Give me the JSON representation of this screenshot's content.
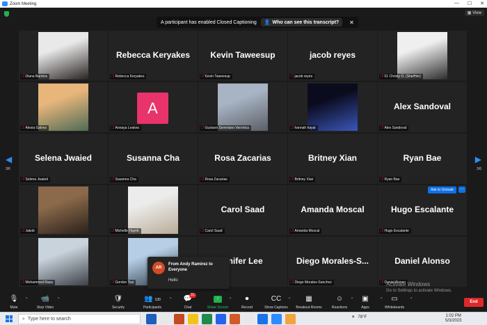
{
  "window": {
    "title": "Zoom Meeting",
    "controls": [
      "—",
      "☐",
      "✕"
    ],
    "view_label": "View"
  },
  "banner": {
    "text": "A participant has enabled Closed Captioning",
    "button_label": "Who can see this transcript?",
    "close_glyph": "✕"
  },
  "pagination": {
    "left": "3/6",
    "right": "3/6",
    "left_arrow": "◀",
    "right_arrow": "▶"
  },
  "participants": [
    {
      "name": "Diana Barrera",
      "type": "photo",
      "colors": [
        "#e9e9e9",
        "#2a2523"
      ]
    },
    {
      "name": "Rebecca Keryakes",
      "type": "name"
    },
    {
      "name": "Kevin Taweesup",
      "type": "name"
    },
    {
      "name": "jacob reyes",
      "type": "name"
    },
    {
      "name": "01 Christy O. (She/Her)",
      "type": "photo",
      "colors": [
        "#efefef",
        "#2e2e2e"
      ]
    },
    {
      "name": "Alexia Galvez",
      "type": "photo",
      "colors": [
        "#e8b57a",
        "#4d6b57"
      ]
    },
    {
      "name": "Annaya Leakes",
      "type": "avatar",
      "avatar_letter": "A"
    },
    {
      "name": "Gustavo Severiano Veronica",
      "type": "photo",
      "colors": [
        "#a8b4c4",
        "#5a5f66"
      ]
    },
    {
      "name": "hannah hayal",
      "type": "photo",
      "colors": [
        "#0b0b1e",
        "#3a56b8"
      ]
    },
    {
      "name": "Alex Sandoval",
      "type": "name"
    },
    {
      "name": "Selena Jwaied",
      "type": "name"
    },
    {
      "name": "Susanna Cha",
      "type": "name"
    },
    {
      "name": "Rosa Zacarias",
      "type": "name"
    },
    {
      "name": "Britney Xian",
      "type": "name"
    },
    {
      "name": "Ryan Bae",
      "type": "name"
    },
    {
      "name": "Jakob",
      "type": "photo",
      "colors": [
        "#8b6a4b",
        "#2b211a"
      ]
    },
    {
      "name": "Michelle Huynh",
      "type": "photo",
      "colors": [
        "#ececec",
        "#b9ac97"
      ]
    },
    {
      "name": "Carol Saad",
      "type": "name"
    },
    {
      "name": "Amanda Moscal",
      "type": "name"
    },
    {
      "name": "Hugo Escalante",
      "type": "name",
      "ask_to_unmute": "Ask to Unmute",
      "more": "···"
    },
    {
      "name": "Mohammed Raza",
      "type": "photo",
      "colors": [
        "#c9d3dc",
        "#3d4147"
      ]
    },
    {
      "name": "Gordon Tsui",
      "type": "photo",
      "colors": [
        "#b7cfe6",
        "#2d3b4a"
      ]
    },
    {
      "name": "Jennifer Lee",
      "type": "name",
      "big_label": "nnifer Lee"
    },
    {
      "name": "Diego Morales-Sanchez",
      "type": "name",
      "big_label": "Diego Morales-S..."
    },
    {
      "name": "Daniel Alonso",
      "type": "name"
    }
  ],
  "chat_popup": {
    "avatar": "AR",
    "from": "From Andy Ramirez to Everyone",
    "message": "Hello"
  },
  "toolbar": {
    "items": [
      {
        "label": "Mute",
        "icon": "🎙"
      },
      {
        "label": "Stop Video",
        "icon": "📹"
      },
      {
        "label": "Security",
        "icon": "🛡"
      },
      {
        "label": "Participants",
        "icon": "👥",
        "count": "130"
      },
      {
        "label": "Chat",
        "icon": "💬"
      },
      {
        "label": "Share Screen",
        "icon": "↑"
      },
      {
        "label": "Record",
        "icon": "⏺"
      },
      {
        "label": "Show Captions",
        "icon": "CC"
      },
      {
        "label": "Breakout Rooms",
        "icon": "▦"
      },
      {
        "label": "Reactions",
        "icon": "☺"
      },
      {
        "label": "Apps",
        "icon": "▣"
      },
      {
        "label": "Whiteboards",
        "icon": "▭"
      }
    ],
    "chat_badge": "31",
    "end_label": "End",
    "activate_title": "Activate Windows",
    "activate_sub": "Go to Settings to activate Windows."
  },
  "taskbar": {
    "search_placeholder": "Type here to search",
    "weather": "78°F",
    "time": "1:02 PM",
    "date": "5/3/2023",
    "app_colors": [
      "#1e5fbd",
      "#e8e8e8",
      "#c24b1f",
      "#f0c419",
      "#1f8a4c",
      "#2563eb",
      "#d15a2a",
      "#e8e8e8",
      "#1a73e8",
      "#2d8cff",
      "#f3a33b"
    ]
  }
}
